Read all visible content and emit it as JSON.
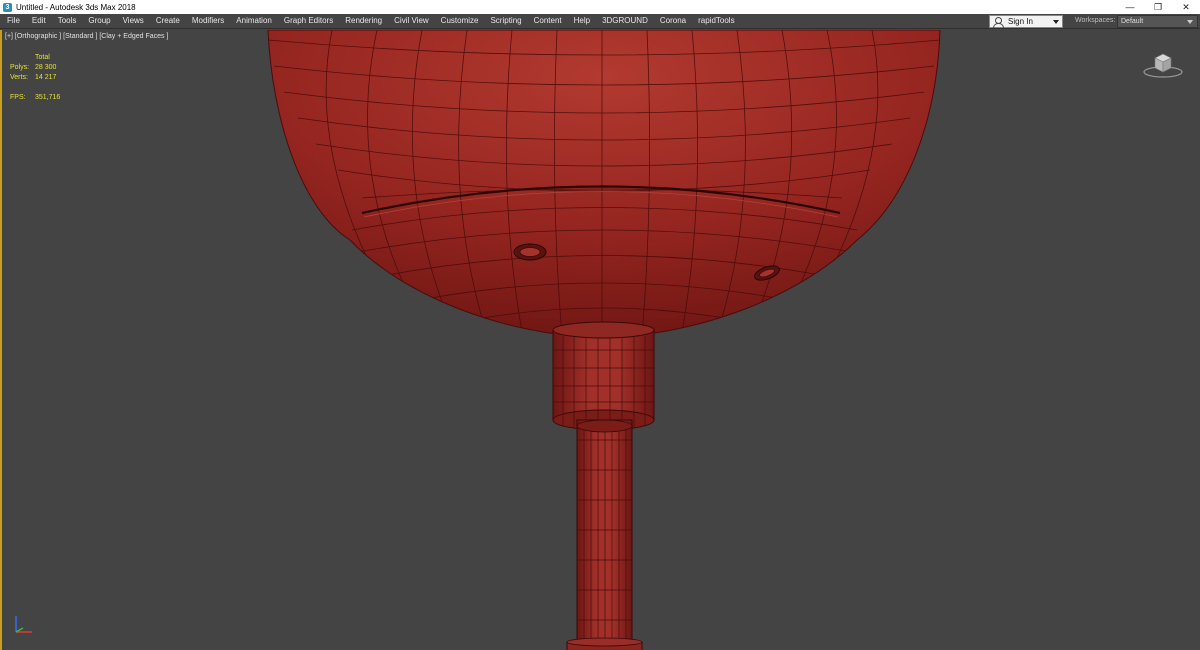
{
  "window": {
    "title": "Untitled - Autodesk 3ds Max 2018",
    "minimize_glyph": "—",
    "restore_glyph": "❐",
    "close_glyph": "✕"
  },
  "menu": {
    "items": [
      "File",
      "Edit",
      "Tools",
      "Group",
      "Views",
      "Create",
      "Modifiers",
      "Animation",
      "Graph Editors",
      "Rendering",
      "Civil View",
      "Customize",
      "Scripting",
      "Content",
      "Help",
      "3DGROUND",
      "Corona",
      "rapidTools"
    ],
    "sign_in_label": "Sign In",
    "workspaces_label": "Workspaces:",
    "workspaces_value": "Default"
  },
  "viewport": {
    "label": "[+] [Orthographic ] [Standard ] [Clay + Edged Faces ]",
    "stats": {
      "header": "Total",
      "polys_label": "Polys:",
      "polys_value": "28 300",
      "verts_label": "Verts:",
      "verts_value": "14 217",
      "fps_label": "FPS:",
      "fps_value": "351,716"
    },
    "icons": {
      "viewcube": "viewcube-icon",
      "axis": "axis-tripod-icon"
    },
    "colors": {
      "background": "#444444",
      "model_fill": "#8f1f1a",
      "wire": "#4a0c0a",
      "stats_text": "#e4e42a",
      "active_border": "#c89e18"
    }
  }
}
